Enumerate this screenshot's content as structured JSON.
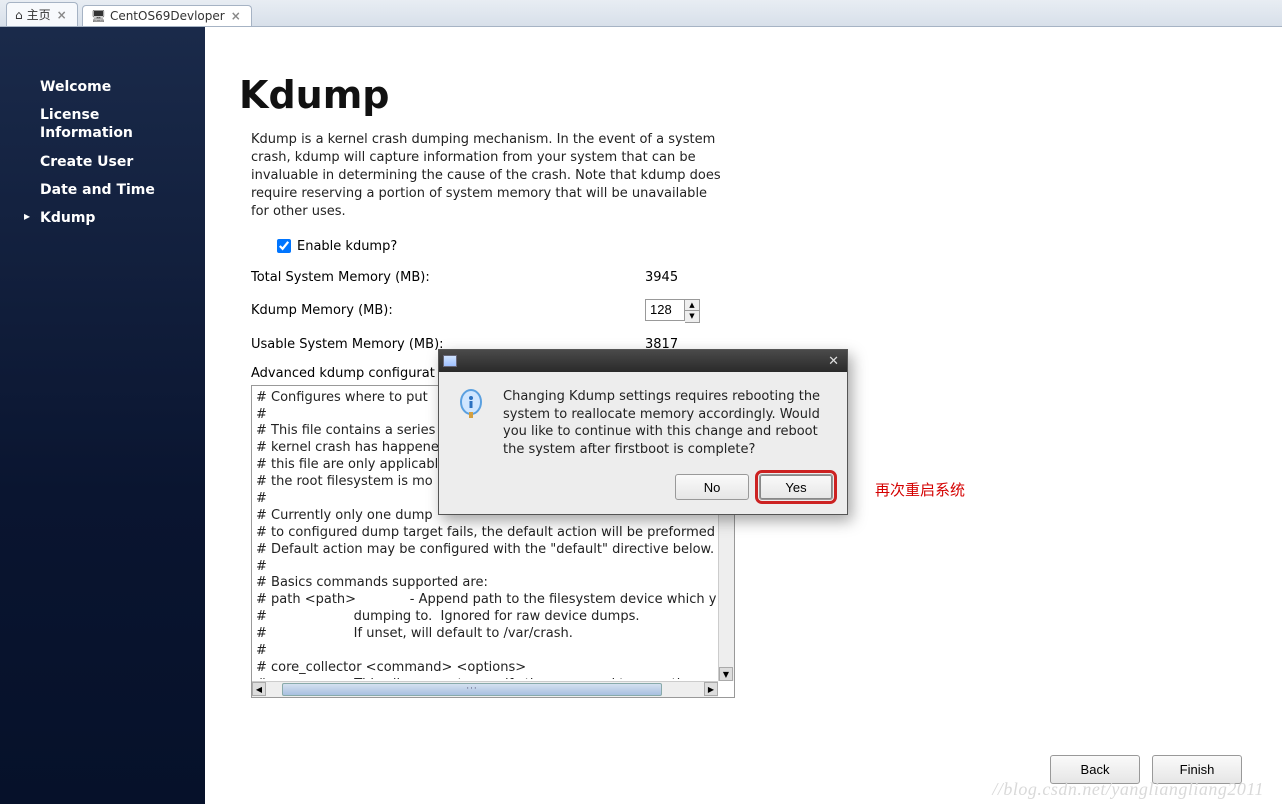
{
  "tabs": [
    {
      "label": "主页",
      "icon": "home"
    },
    {
      "label": "CentOS69Devloper",
      "icon": "vm"
    }
  ],
  "sidebar": {
    "items": [
      {
        "label": "Welcome"
      },
      {
        "label": "License Information"
      },
      {
        "label": "Create User"
      },
      {
        "label": "Date and Time"
      },
      {
        "label": "Kdump"
      }
    ]
  },
  "page": {
    "title": "Kdump",
    "description": "Kdump is a kernel crash dumping mechanism. In the event of a system crash, kdump will capture information from your system that can be invaluable in determining the cause of the crash. Note that kdump does require reserving a portion of system memory that will be unavailable for other uses.",
    "enable_label": "Enable kdump?",
    "enable_checked": true,
    "total_mem_label": "Total System Memory (MB):",
    "total_mem_value": "3945",
    "kdump_mem_label": "Kdump Memory (MB):",
    "kdump_mem_value": "128",
    "usable_mem_label": "Usable System Memory (MB):",
    "usable_mem_value": "3817",
    "advanced_label": "Advanced kdump configurat",
    "advanced_text": "# Configures where to put\n#\n# This file contains a series\n# kernel crash has happene\n# this file are only applicabl\n# the root filesystem is mo\n#\n# Currently only one dump\n# to configured dump target fails, the default action will be preformed.\n# Default action may be configured with the \"default\" directive below.\n#\n# Basics commands supported are:\n# path <path>             - Append path to the filesystem device which y\n#                     dumping to.  Ignored for raw device dumps.\n#                     If unset, will default to /var/crash.\n#\n# core_collector <command> <options>\n#                   - This allows you to specify the command to copy the"
  },
  "dialog": {
    "message": "Changing Kdump settings requires rebooting the system to reallocate memory accordingly. Would you like to continue with this change and reboot the system after firstboot is complete?",
    "no_label": "No",
    "yes_label": "Yes"
  },
  "annotation": "再次重启系统",
  "footer": {
    "back_label": "Back",
    "finish_label": "Finish"
  },
  "watermark": "//blog.csdn.net/yangliangliang2011"
}
